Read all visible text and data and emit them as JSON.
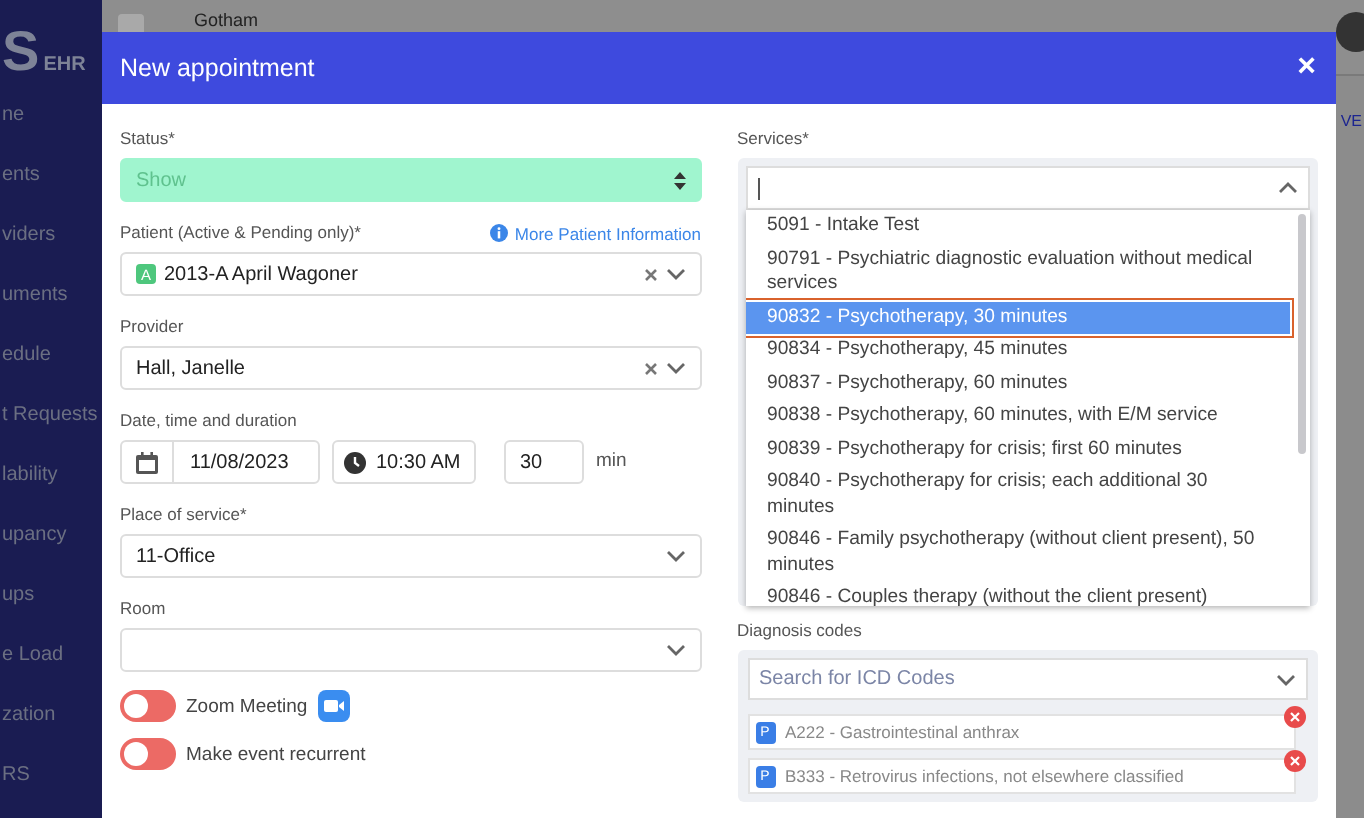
{
  "sidebar": {
    "logo": {
      "letter": "S",
      "suffix": "EHR"
    },
    "items": [
      "ne",
      "ents",
      "viders",
      "uments",
      "edule",
      "t Requests",
      "lability",
      "upancy",
      "ups",
      "e Load",
      "zation",
      "RS"
    ]
  },
  "topbar": {
    "location": "Gotham",
    "side_text": "VE"
  },
  "modal": {
    "title": "New appointment",
    "close": "×",
    "status": {
      "label": "Status*",
      "value": "Show"
    },
    "patient": {
      "label": "Patient (Active & Pending only)*",
      "info_link": "More Patient Information",
      "badge": "A",
      "value": "2013-A April Wagoner"
    },
    "provider": {
      "label": "Provider",
      "value": "Hall, Janelle"
    },
    "datetime": {
      "label": "Date, time and duration",
      "date": "11/08/2023",
      "time": "10:30 AM",
      "duration": "30",
      "unit": "min"
    },
    "place": {
      "label": "Place of service*",
      "value": "11-Office"
    },
    "room": {
      "label": "Room"
    },
    "toggles": [
      {
        "kind": "video",
        "label": "Zoom Meeting",
        "on": false
      },
      {
        "kind": "plain",
        "label": "Make event recurrent",
        "on": false
      }
    ],
    "services": {
      "label": "Services*",
      "options": [
        {
          "text": "5091 - Intake Test",
          "selected": false
        },
        {
          "text": "90791 - Psychiatric diagnostic evaluation without medical services",
          "selected": false
        },
        {
          "text": "90832 - Psychotherapy, 30 minutes",
          "selected": true
        },
        {
          "text": "90834 - Psychotherapy, 45 minutes",
          "selected": false
        },
        {
          "text": "90837 - Psychotherapy, 60 minutes",
          "selected": false
        },
        {
          "text": "90838 - Psychotherapy, 60 minutes, with E/M service",
          "selected": false
        },
        {
          "text": "90839 - Psychotherapy for crisis; first 60 minutes",
          "selected": false
        },
        {
          "text": "90840 - Psychotherapy for crisis; each additional 30 minutes",
          "selected": false
        },
        {
          "text": "90846 - Family psychotherapy (without client present), 50 minutes",
          "selected": false
        },
        {
          "text": "90846 - Couples therapy (without the client present)",
          "selected": false
        }
      ]
    },
    "diagnosis": {
      "label": "Diagnosis codes",
      "placeholder": "Search for ICD Codes",
      "codes": [
        {
          "badge": "P",
          "text": "A222 - Gastrointestinal anthrax"
        },
        {
          "badge": "P",
          "text": "B333 - Retrovirus infections, not elsewhere classified"
        }
      ]
    }
  }
}
